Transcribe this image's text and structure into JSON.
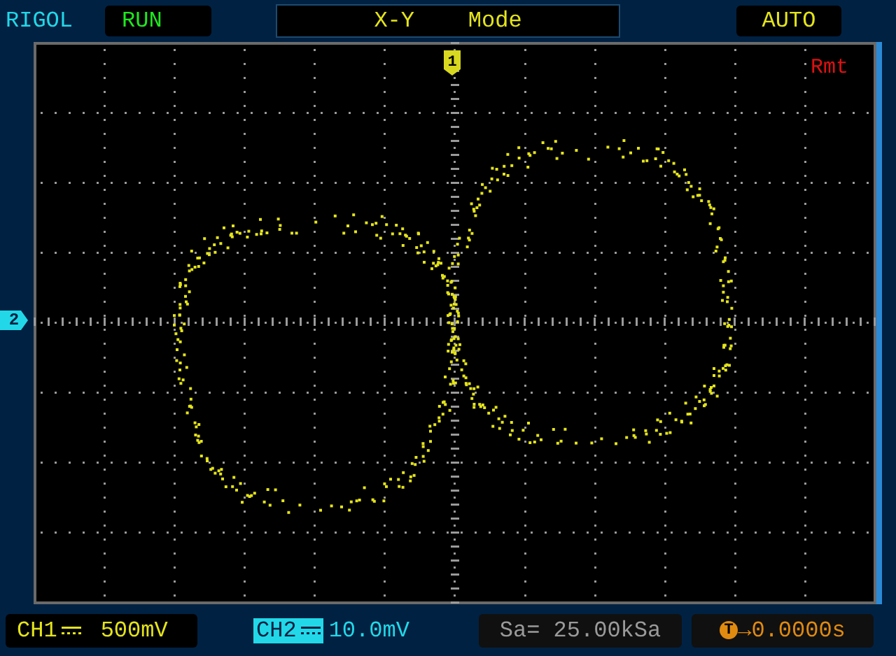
{
  "header": {
    "brand": "RIGOL",
    "run_state": "RUN",
    "mode": "X-Y    Mode",
    "trigger_mode": "AUTO"
  },
  "screen": {
    "remote": "Rmt",
    "ch1_marker": "1",
    "ch2_marker": "2"
  },
  "status_bar": {
    "ch1": {
      "label": "CH1",
      "scale": "500mV",
      "selected": false
    },
    "ch2": {
      "label": "CH2",
      "scale": "10.0mV",
      "selected": true
    },
    "sample_rate": "Sa= 25.00kSa",
    "trigger_icon": "T",
    "trigger_offset": "→0.0000s"
  }
}
